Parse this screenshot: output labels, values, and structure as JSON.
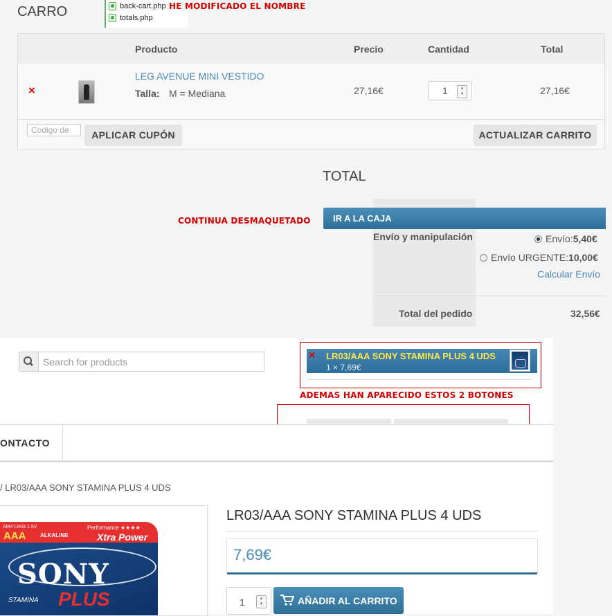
{
  "header": {
    "title": "CARRO",
    "files": [
      "back-cart.php",
      "totals.php"
    ],
    "annotation_rename": "HE MODIFICADO EL NOMBRE"
  },
  "cart": {
    "columns": [
      "Producto",
      "Precio",
      "Cantidad",
      "Total"
    ],
    "item": {
      "remove_icon": "×",
      "name": "LEG AVENUE MINI VESTIDO",
      "attr_label": "Talla:",
      "attr_value": "M = Mediana",
      "price": "27,16€",
      "quantity": "1",
      "total": "27,16€"
    },
    "coupon_placeholder": "Codigo de",
    "apply_coupon": "APLICAR CUPÓN",
    "update_cart": "ACTUALIZAR CARRITO"
  },
  "totals": {
    "title": "TOTAL",
    "annotation_unstyled": "CONTINUA DESMAQUETADO",
    "checkout": "IR A LA CAJA",
    "shipping_label": "Envío y manipulación",
    "shipping_option_1_label": "Envío: ",
    "shipping_option_1_price": "5,40€",
    "shipping_option_2_label": "Envío URGENTE: ",
    "shipping_option_2_price": "10,00€",
    "calc_shipping": "Calcular Envío",
    "order_total_label": "Total del pedido",
    "order_total": "32,56€"
  },
  "header2": {
    "search_placeholder": "Search for products",
    "mini_cart": {
      "item_name": "LR03/AAA SONY STAMINA PLUS 4 UDS",
      "item_qty": "1 × 7,69€"
    },
    "annotation_buttons": "ADEMAS HAN APARECIDO ESTOS 2 BOTONES",
    "nav_item": "ONTACTO"
  },
  "product": {
    "breadcrumb": "/ LR03/AAA SONY STAMINA PLUS 4 UDS",
    "title": "LR03/AAA SONY STAMINA PLUS 4 UDS",
    "price": "7,69€",
    "quantity": "1",
    "add_to_cart": "AÑADIR AL CARRITO",
    "image_text": {
      "brand": "SONY",
      "size": "AAA",
      "top_line": "AM4 LR03 1.5V",
      "type": "ALKALINE",
      "performance": "Performance ★★★★",
      "power": "Xtra Power",
      "stamina": "STAMINA",
      "plus": "PLUS"
    }
  },
  "colors": {
    "accent": "#3a7fa8",
    "link": "#4a8aba",
    "annotation": "#d20000"
  }
}
